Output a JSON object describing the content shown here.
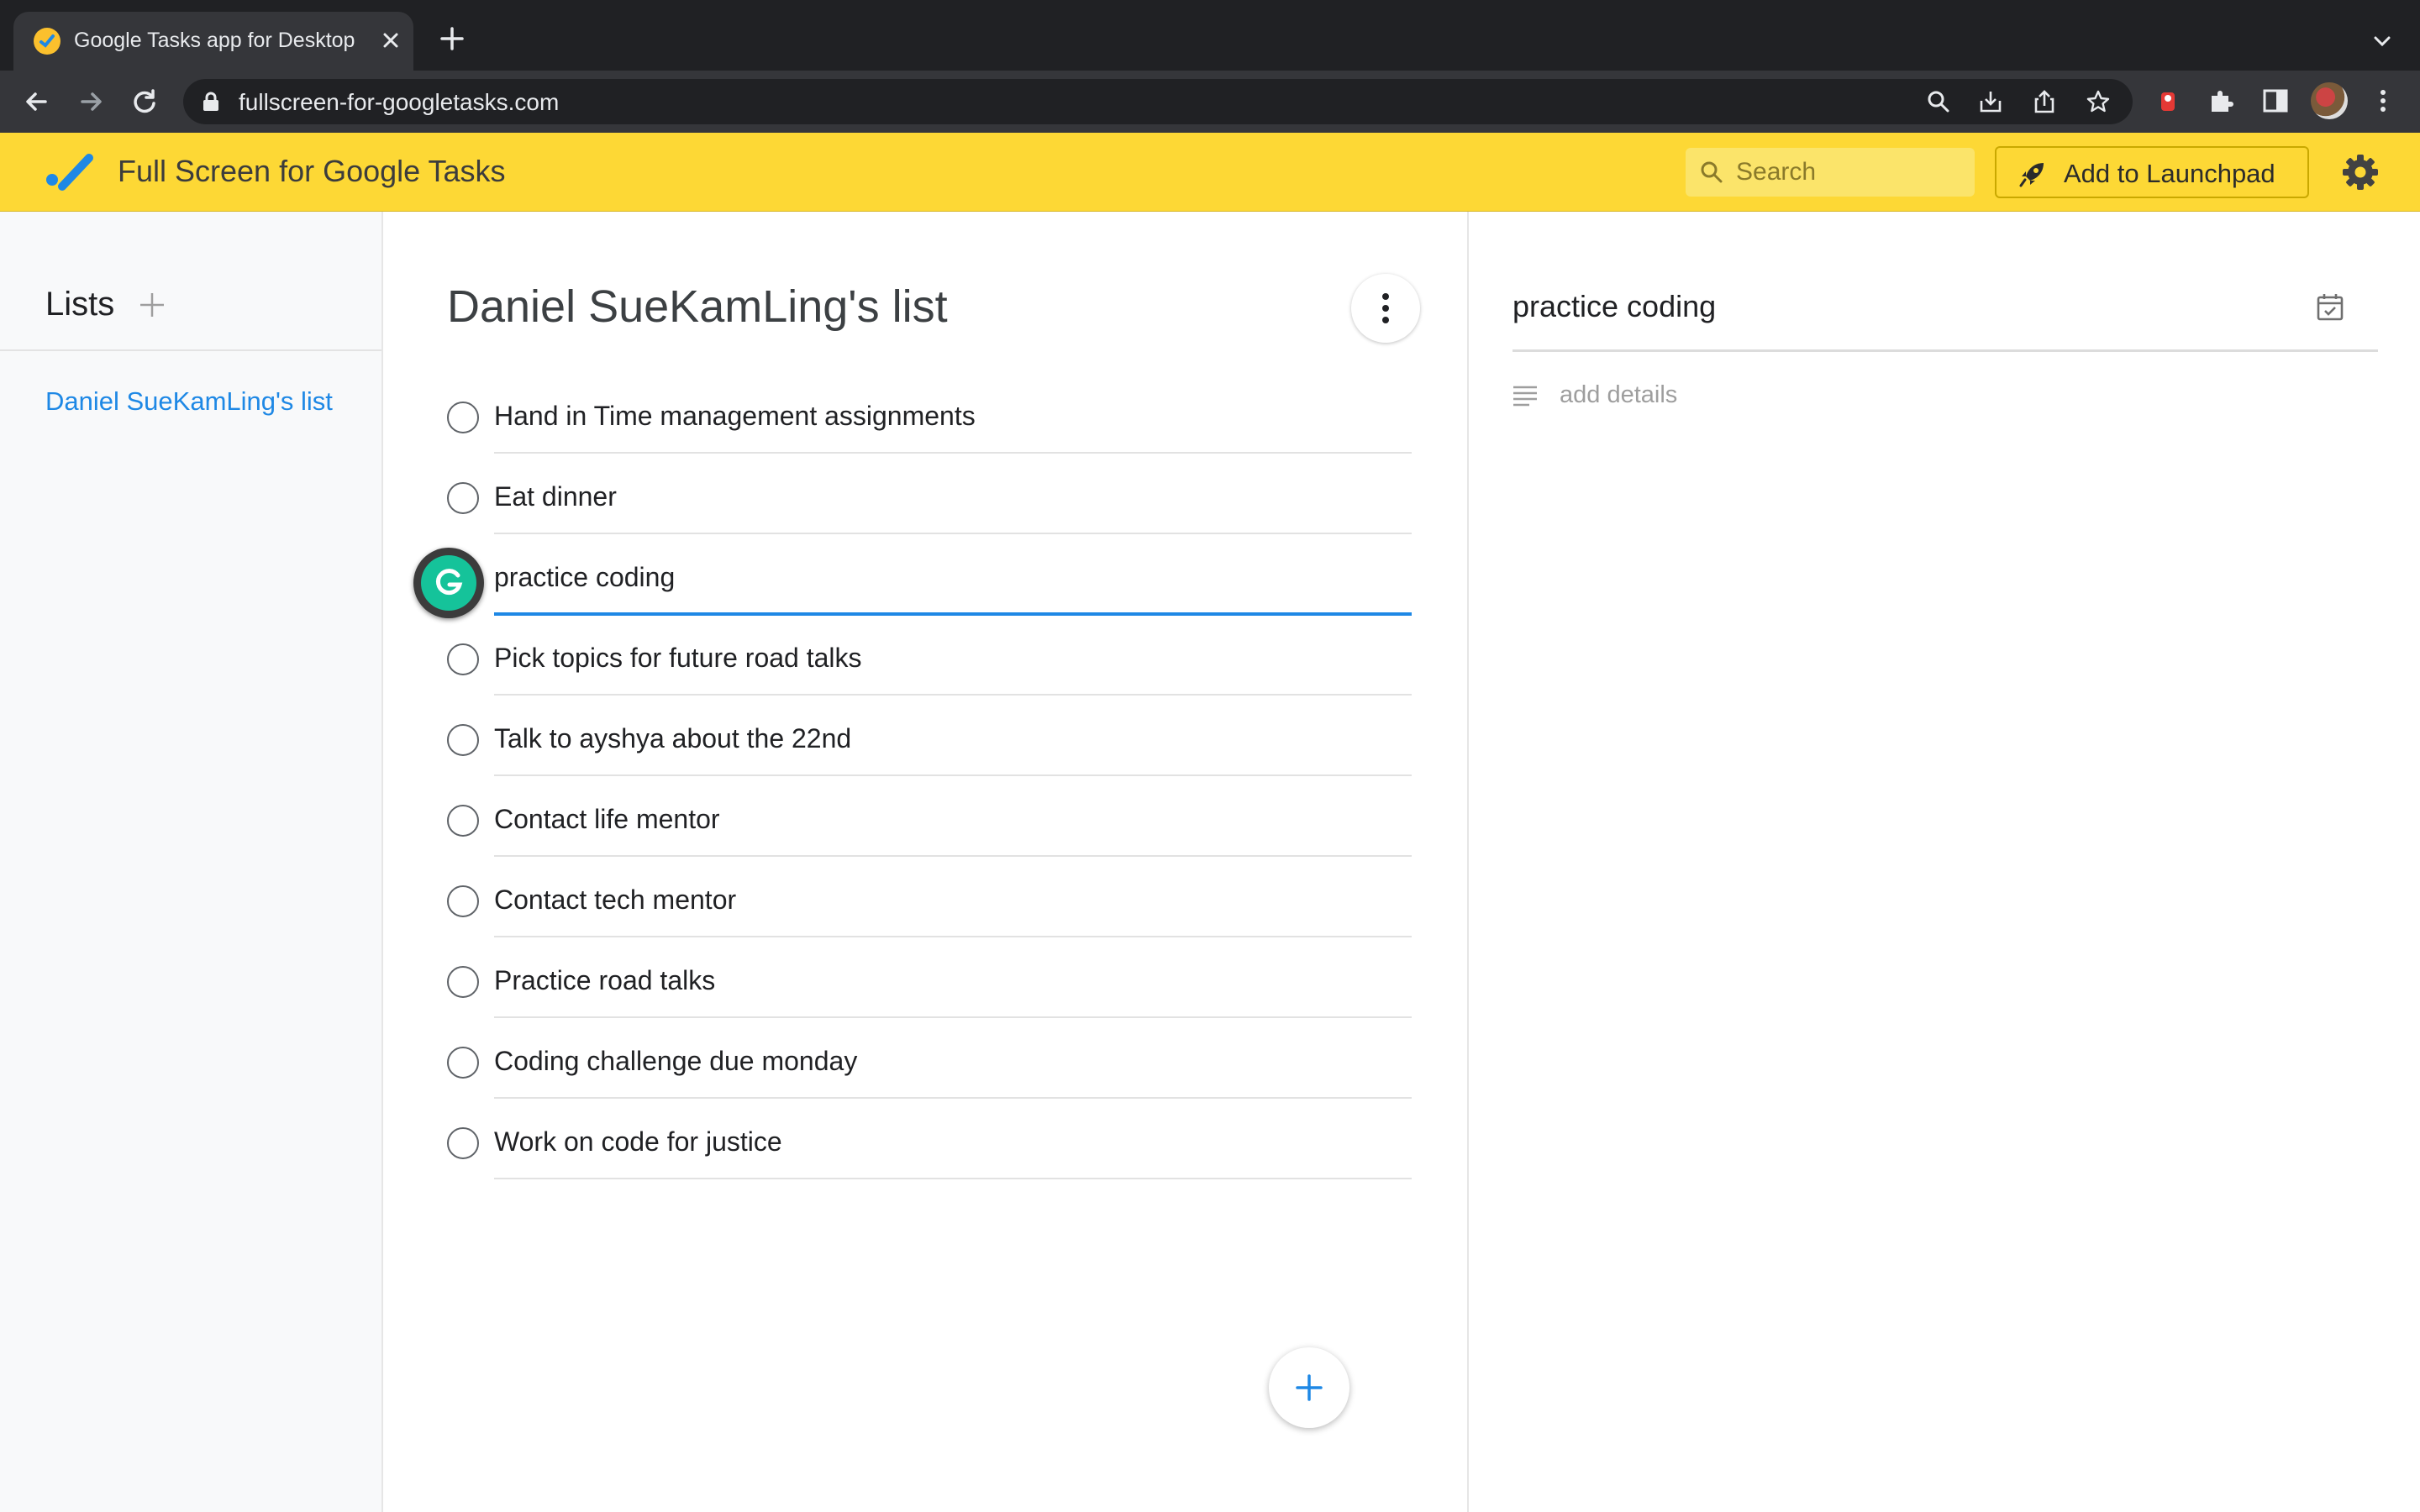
{
  "browser": {
    "tab_title": "Google Tasks app for Desktop",
    "url": "fullscreen-for-googletasks.com"
  },
  "app": {
    "title": "Full Screen for Google Tasks",
    "search_placeholder": "Search",
    "launchpad_label": "Add to Launchpad",
    "accent_color": "#fdd835"
  },
  "sidebar": {
    "heading": "Lists",
    "lists": [
      "Daniel SueKamLing's list"
    ]
  },
  "main": {
    "list_title": "Daniel SueKamLing's list",
    "tasks": [
      "Hand in Time management assignments",
      "Eat dinner",
      "practice coding",
      "Pick topics for future road talks",
      "Talk to ayshya about the 22nd",
      "Contact life mentor",
      "Contact tech mentor",
      "Practice road talks",
      "Coding challenge due monday",
      "Work on code for justice"
    ]
  },
  "details": {
    "title": "practice coding",
    "notes_placeholder": "add details"
  }
}
